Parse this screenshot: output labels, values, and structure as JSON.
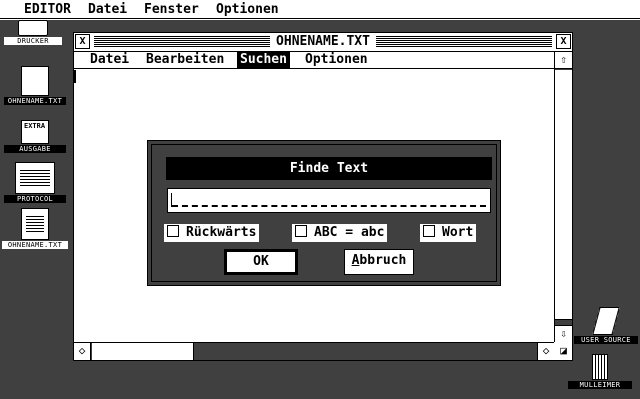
{
  "menubar": {
    "items": [
      "EDITOR",
      "Datei",
      "Fenster",
      "Optionen"
    ]
  },
  "desktop": {
    "icons": [
      {
        "label": "DRUCKER"
      },
      {
        "label": "OHNENAME.TXT"
      },
      {
        "label": "AUSGABE",
        "art_text": "EXTRA"
      },
      {
        "label": "PROTOCOL"
      },
      {
        "label": "OHNENAME.TXT"
      },
      {
        "label": "USER SOURCE"
      },
      {
        "label": "MULLEIMER"
      }
    ]
  },
  "window": {
    "title": "OHNENAME.TXT",
    "close_glyph": "X",
    "full_glyph": "X",
    "menu": [
      "Datei",
      "Bearbeiten",
      "Suchen",
      "Optionen"
    ],
    "active_menu": "Suchen",
    "scroll_up": "⇧",
    "scroll_down": "⇩",
    "scroll_left": "◇",
    "scroll_right": "◇",
    "size_glyph": "◪"
  },
  "dialog": {
    "title": "Finde Text",
    "search_value": "",
    "options": [
      {
        "label": "Rückwärts",
        "checked": false
      },
      {
        "label": "ABC = abc",
        "checked": false
      },
      {
        "label": "Wort",
        "checked": false
      }
    ],
    "ok_label": "OK",
    "cancel_label": "Abbruch",
    "cancel_underline": "A",
    "cancel_rest": "bbruch"
  }
}
